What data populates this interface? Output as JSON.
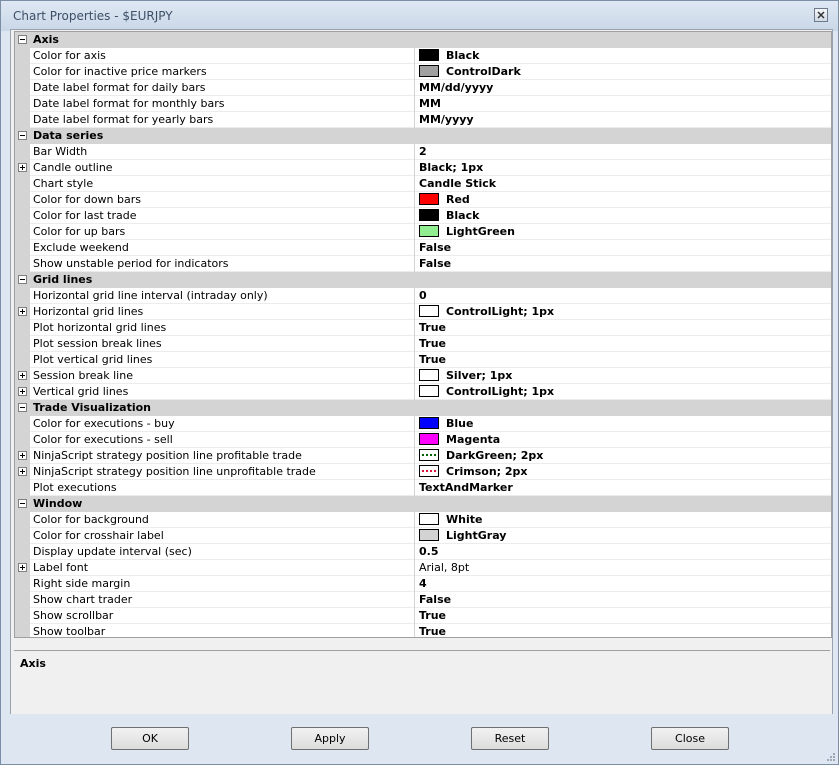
{
  "window": {
    "title": "Chart Properties - $EURJPY"
  },
  "colors": {
    "accent": "#d4d4d4",
    "titlebar": "#c9d7e8"
  },
  "categories": [
    {
      "name": "Axis",
      "rows": [
        {
          "label": "Color for axis",
          "value": "Black",
          "swatch": "#000000"
        },
        {
          "label": "Color for inactive price markers",
          "value": "ControlDark",
          "swatch": "#a0a0a0"
        },
        {
          "label": "Date label format for daily bars",
          "value": "MM/dd/yyyy"
        },
        {
          "label": "Date label format for monthly bars",
          "value": "MM"
        },
        {
          "label": "Date label format for yearly bars",
          "value": "MM/yyyy"
        }
      ]
    },
    {
      "name": "Data series",
      "rows": [
        {
          "label": "Bar Width",
          "value": "2"
        },
        {
          "label": "Candle outline",
          "value": "Black; 1px",
          "expandable": true
        },
        {
          "label": "Chart style",
          "value": "Candle Stick"
        },
        {
          "label": "Color for down bars",
          "value": "Red",
          "swatch": "#ff0000"
        },
        {
          "label": "Color for last trade",
          "value": "Black",
          "swatch": "#000000"
        },
        {
          "label": "Color for up bars",
          "value": "LightGreen",
          "swatch": "#90ee90"
        },
        {
          "label": "Exclude weekend",
          "value": "False"
        },
        {
          "label": "Show unstable period for indicators",
          "value": "False"
        }
      ]
    },
    {
      "name": "Grid lines",
      "rows": [
        {
          "label": "Horizontal grid line interval (intraday only)",
          "value": "0"
        },
        {
          "label": "Horizontal grid lines",
          "value": "ControlLight; 1px",
          "swatch": "#ffffff",
          "expandable": true
        },
        {
          "label": "Plot horizontal grid lines",
          "value": "True"
        },
        {
          "label": "Plot session break lines",
          "value": "True"
        },
        {
          "label": "Plot vertical grid lines",
          "value": "True"
        },
        {
          "label": "Session break line",
          "value": "Silver; 1px",
          "swatch": "#ffffff",
          "expandable": true
        },
        {
          "label": "Vertical grid lines",
          "value": "ControlLight; 1px",
          "swatch": "#ffffff",
          "expandable": true
        }
      ]
    },
    {
      "name": "Trade Visualization",
      "rows": [
        {
          "label": "Color for executions - buy",
          "value": "Blue",
          "swatch": "#0000ff"
        },
        {
          "label": "Color for executions - sell",
          "value": "Magenta",
          "swatch": "#ff00ff"
        },
        {
          "label": "NinjaScript strategy position line profitable trade",
          "value": "DarkGreen; 2px",
          "swatch": "dotgreen",
          "expandable": true
        },
        {
          "label": "NinjaScript strategy position line unprofitable trade",
          "value": "Crimson; 2px",
          "swatch": "dotcrimson",
          "expandable": true
        },
        {
          "label": "Plot executions",
          "value": "TextAndMarker"
        }
      ]
    },
    {
      "name": "Window",
      "rows": [
        {
          "label": "Color for background",
          "value": "White",
          "swatch": "#ffffff"
        },
        {
          "label": "Color for crosshair label",
          "value": "LightGray",
          "swatch": "#d3d3d3"
        },
        {
          "label": "Display update interval (sec)",
          "value": "0.5"
        },
        {
          "label": "Label font",
          "value": "Arial, 8pt",
          "expandable": true,
          "plain": true
        },
        {
          "label": "Right side margin",
          "value": "4"
        },
        {
          "label": "Show chart trader",
          "value": "False"
        },
        {
          "label": "Show scrollbar",
          "value": "True"
        },
        {
          "label": "Show toolbar",
          "value": "True"
        }
      ]
    }
  ],
  "description": {
    "title": "Axis"
  },
  "buttons": {
    "ok": "OK",
    "apply": "Apply",
    "reset": "Reset",
    "close": "Close"
  }
}
